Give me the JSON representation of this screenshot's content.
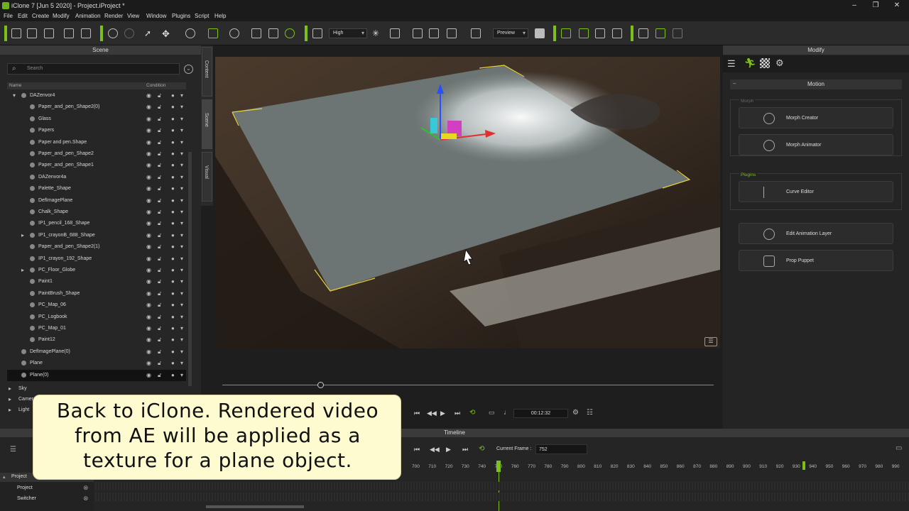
{
  "window": {
    "title": "iClone 7 [Jun  5 2020] - Project.iProject *"
  },
  "menu": [
    "File",
    "Edit",
    "Create",
    "Modify",
    "Animation",
    "Render",
    "View",
    "Window",
    "Plugins",
    "Script",
    "Help"
  ],
  "toolbar": {
    "quality": "High",
    "render_mode": "Preview"
  },
  "scene": {
    "title": "Scene",
    "search_placeholder": "Search",
    "col_name": "Name",
    "col_condition": "Condition",
    "items": [
      {
        "label": "DAZenvor4",
        "indent": 1,
        "expand": "▾"
      },
      {
        "label": "Paper_and_pen_Shape2(0)",
        "indent": 2,
        "expand": ""
      },
      {
        "label": "Glass",
        "indent": 2,
        "expand": ""
      },
      {
        "label": "Papers",
        "indent": 2,
        "expand": ""
      },
      {
        "label": "Paper and pen.Shape",
        "indent": 2,
        "expand": ""
      },
      {
        "label": "Paper_and_pen_Shape2",
        "indent": 2,
        "expand": ""
      },
      {
        "label": "Paper_and_pen_Shape1",
        "indent": 2,
        "expand": ""
      },
      {
        "label": "DAZenvor4a",
        "indent": 2,
        "expand": ""
      },
      {
        "label": "Palette_Shape",
        "indent": 2,
        "expand": ""
      },
      {
        "label": "DefImagePlane",
        "indent": 2,
        "expand": ""
      },
      {
        "label": "Chalk_Shape",
        "indent": 2,
        "expand": ""
      },
      {
        "label": "IP1_pencil_168_Shape",
        "indent": 2,
        "expand": ""
      },
      {
        "label": "IP1_crayonB_688_Shape",
        "indent": 2,
        "expand": "▸"
      },
      {
        "label": "Paper_and_pen_Shape2(1)",
        "indent": 2,
        "expand": ""
      },
      {
        "label": "IP1_crayon_192_Shape",
        "indent": 2,
        "expand": ""
      },
      {
        "label": "PC_Floor_Globe",
        "indent": 2,
        "expand": "▸"
      },
      {
        "label": "Paint1",
        "indent": 2,
        "expand": ""
      },
      {
        "label": "PaintBrush_Shape",
        "indent": 2,
        "expand": ""
      },
      {
        "label": "PC_Map_06",
        "indent": 2,
        "expand": ""
      },
      {
        "label": "PC_Logbook",
        "indent": 2,
        "expand": ""
      },
      {
        "label": "PC_Map_01",
        "indent": 2,
        "expand": ""
      },
      {
        "label": "Paint12",
        "indent": 2,
        "expand": ""
      },
      {
        "label": "DefImagePlane(0)",
        "indent": 1,
        "expand": ""
      },
      {
        "label": "Plane",
        "indent": 1,
        "expand": ""
      },
      {
        "label": "Plane(0)",
        "indent": 1,
        "expand": ""
      }
    ],
    "root_items": [
      "Sky",
      "Camera",
      "Light"
    ]
  },
  "side_tabs": [
    "Content",
    "Scene",
    "Visual"
  ],
  "modify": {
    "title": "Modify",
    "section": "Motion",
    "group_morph": "Morph",
    "group_plugins": "Plugins",
    "buttons": {
      "morph_creator": "Morph Creator",
      "morph_animator": "Morph Animator",
      "curve_editor": "Curve Editor",
      "edit_animation_layer": "Edit Animation Layer",
      "prop_puppet": "Prop Puppet"
    }
  },
  "playback": {
    "time": "00:12:32"
  },
  "timeline": {
    "title": "Timeline",
    "current_frame_label": "Current Frame :",
    "current_frame": "752",
    "ticks": [
      "700",
      "710",
      "720",
      "730",
      "740",
      "750",
      "760",
      "770",
      "780",
      "790",
      "800",
      "810",
      "820",
      "830",
      "840",
      "850",
      "860",
      "870",
      "880",
      "890",
      "900",
      "910",
      "920",
      "930",
      "940",
      "950",
      "960",
      "970",
      "980",
      "990"
    ],
    "tracks": [
      "Project",
      "Project",
      "Switcher"
    ]
  },
  "caption": {
    "line1": "Back to iClone. Rendered video",
    "line2": "from AE will be applied as a",
    "line3": "texture for a plane object."
  },
  "colors": {
    "accent": "#7cc019",
    "caption_bg": "#fffbd0"
  }
}
